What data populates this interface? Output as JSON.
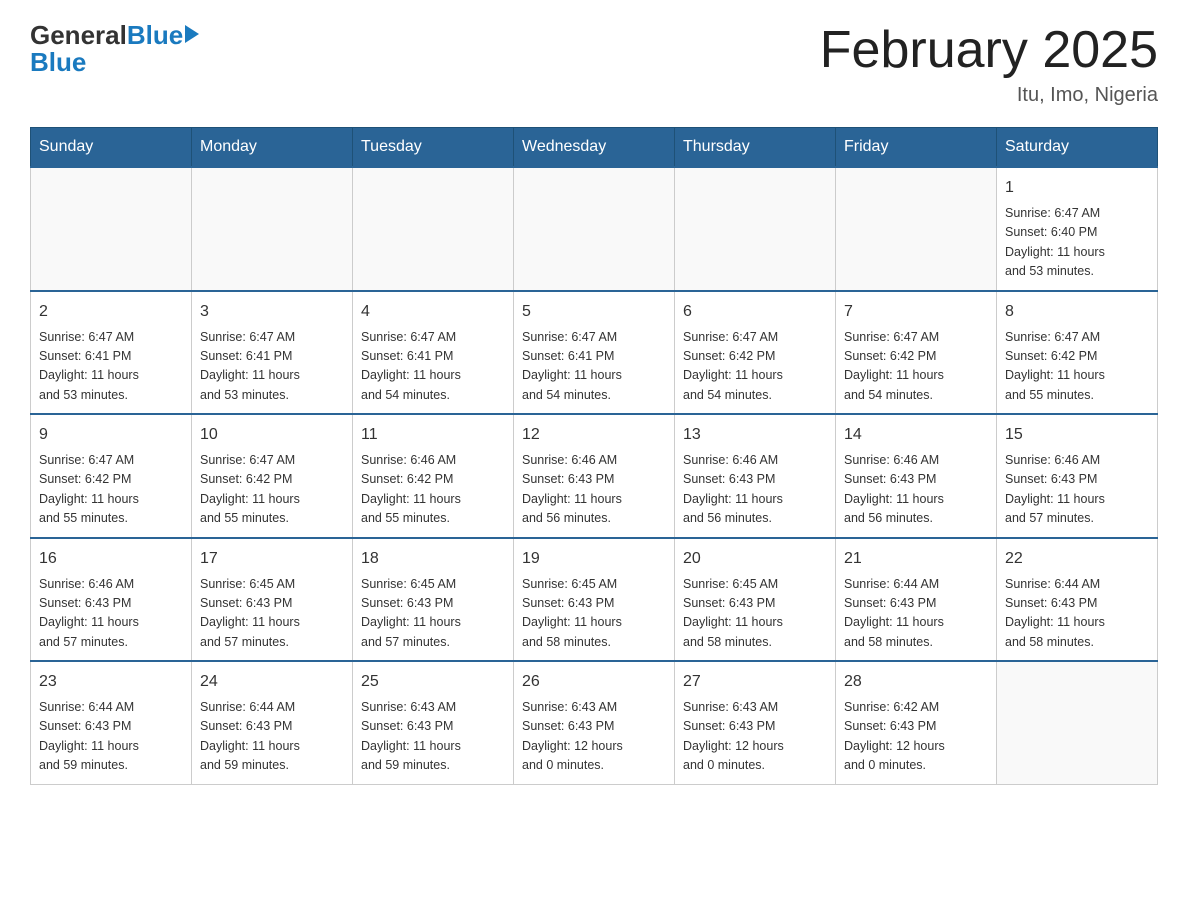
{
  "header": {
    "logo_general": "General",
    "logo_blue": "Blue",
    "title": "February 2025",
    "subtitle": "Itu, Imo, Nigeria"
  },
  "days_of_week": [
    "Sunday",
    "Monday",
    "Tuesday",
    "Wednesday",
    "Thursday",
    "Friday",
    "Saturday"
  ],
  "weeks": [
    {
      "days": [
        {
          "number": "",
          "info": ""
        },
        {
          "number": "",
          "info": ""
        },
        {
          "number": "",
          "info": ""
        },
        {
          "number": "",
          "info": ""
        },
        {
          "number": "",
          "info": ""
        },
        {
          "number": "",
          "info": ""
        },
        {
          "number": "1",
          "info": "Sunrise: 6:47 AM\nSunset: 6:40 PM\nDaylight: 11 hours\nand 53 minutes."
        }
      ]
    },
    {
      "days": [
        {
          "number": "2",
          "info": "Sunrise: 6:47 AM\nSunset: 6:41 PM\nDaylight: 11 hours\nand 53 minutes."
        },
        {
          "number": "3",
          "info": "Sunrise: 6:47 AM\nSunset: 6:41 PM\nDaylight: 11 hours\nand 53 minutes."
        },
        {
          "number": "4",
          "info": "Sunrise: 6:47 AM\nSunset: 6:41 PM\nDaylight: 11 hours\nand 54 minutes."
        },
        {
          "number": "5",
          "info": "Sunrise: 6:47 AM\nSunset: 6:41 PM\nDaylight: 11 hours\nand 54 minutes."
        },
        {
          "number": "6",
          "info": "Sunrise: 6:47 AM\nSunset: 6:42 PM\nDaylight: 11 hours\nand 54 minutes."
        },
        {
          "number": "7",
          "info": "Sunrise: 6:47 AM\nSunset: 6:42 PM\nDaylight: 11 hours\nand 54 minutes."
        },
        {
          "number": "8",
          "info": "Sunrise: 6:47 AM\nSunset: 6:42 PM\nDaylight: 11 hours\nand 55 minutes."
        }
      ]
    },
    {
      "days": [
        {
          "number": "9",
          "info": "Sunrise: 6:47 AM\nSunset: 6:42 PM\nDaylight: 11 hours\nand 55 minutes."
        },
        {
          "number": "10",
          "info": "Sunrise: 6:47 AM\nSunset: 6:42 PM\nDaylight: 11 hours\nand 55 minutes."
        },
        {
          "number": "11",
          "info": "Sunrise: 6:46 AM\nSunset: 6:42 PM\nDaylight: 11 hours\nand 55 minutes."
        },
        {
          "number": "12",
          "info": "Sunrise: 6:46 AM\nSunset: 6:43 PM\nDaylight: 11 hours\nand 56 minutes."
        },
        {
          "number": "13",
          "info": "Sunrise: 6:46 AM\nSunset: 6:43 PM\nDaylight: 11 hours\nand 56 minutes."
        },
        {
          "number": "14",
          "info": "Sunrise: 6:46 AM\nSunset: 6:43 PM\nDaylight: 11 hours\nand 56 minutes."
        },
        {
          "number": "15",
          "info": "Sunrise: 6:46 AM\nSunset: 6:43 PM\nDaylight: 11 hours\nand 57 minutes."
        }
      ]
    },
    {
      "days": [
        {
          "number": "16",
          "info": "Sunrise: 6:46 AM\nSunset: 6:43 PM\nDaylight: 11 hours\nand 57 minutes."
        },
        {
          "number": "17",
          "info": "Sunrise: 6:45 AM\nSunset: 6:43 PM\nDaylight: 11 hours\nand 57 minutes."
        },
        {
          "number": "18",
          "info": "Sunrise: 6:45 AM\nSunset: 6:43 PM\nDaylight: 11 hours\nand 57 minutes."
        },
        {
          "number": "19",
          "info": "Sunrise: 6:45 AM\nSunset: 6:43 PM\nDaylight: 11 hours\nand 58 minutes."
        },
        {
          "number": "20",
          "info": "Sunrise: 6:45 AM\nSunset: 6:43 PM\nDaylight: 11 hours\nand 58 minutes."
        },
        {
          "number": "21",
          "info": "Sunrise: 6:44 AM\nSunset: 6:43 PM\nDaylight: 11 hours\nand 58 minutes."
        },
        {
          "number": "22",
          "info": "Sunrise: 6:44 AM\nSunset: 6:43 PM\nDaylight: 11 hours\nand 58 minutes."
        }
      ]
    },
    {
      "days": [
        {
          "number": "23",
          "info": "Sunrise: 6:44 AM\nSunset: 6:43 PM\nDaylight: 11 hours\nand 59 minutes."
        },
        {
          "number": "24",
          "info": "Sunrise: 6:44 AM\nSunset: 6:43 PM\nDaylight: 11 hours\nand 59 minutes."
        },
        {
          "number": "25",
          "info": "Sunrise: 6:43 AM\nSunset: 6:43 PM\nDaylight: 11 hours\nand 59 minutes."
        },
        {
          "number": "26",
          "info": "Sunrise: 6:43 AM\nSunset: 6:43 PM\nDaylight: 12 hours\nand 0 minutes."
        },
        {
          "number": "27",
          "info": "Sunrise: 6:43 AM\nSunset: 6:43 PM\nDaylight: 12 hours\nand 0 minutes."
        },
        {
          "number": "28",
          "info": "Sunrise: 6:42 AM\nSunset: 6:43 PM\nDaylight: 12 hours\nand 0 minutes."
        },
        {
          "number": "",
          "info": ""
        }
      ]
    }
  ]
}
